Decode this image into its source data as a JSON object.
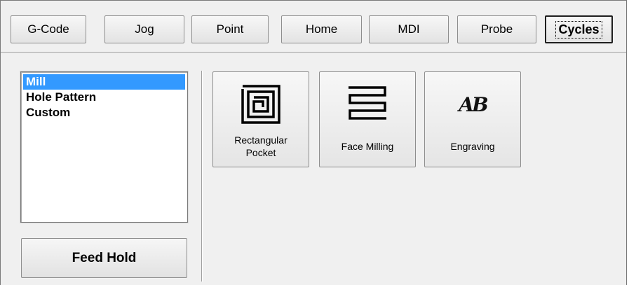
{
  "tabs": [
    {
      "label": "G-Code",
      "active": false
    },
    {
      "label": "Jog",
      "active": false
    },
    {
      "label": "Point",
      "active": false
    },
    {
      "label": "Home",
      "active": false
    },
    {
      "label": "MDI",
      "active": false
    },
    {
      "label": "Probe",
      "active": false
    },
    {
      "label": "Cycles",
      "active": true
    }
  ],
  "cycle_categories": {
    "items": [
      "Mill",
      "Hole Pattern",
      "Custom"
    ],
    "selected": "Mill"
  },
  "feed_hold": {
    "label": "Feed Hold"
  },
  "cycles": [
    {
      "label": "Rectangular Pocket",
      "icon": "rectangular-pocket-icon"
    },
    {
      "label": "Face Milling",
      "icon": "face-milling-icon"
    },
    {
      "label": "Engraving",
      "icon": "engraving-icon",
      "glyph": "AB"
    }
  ],
  "colors": {
    "selection": "#3399ff",
    "background": "#f0f0f0"
  }
}
